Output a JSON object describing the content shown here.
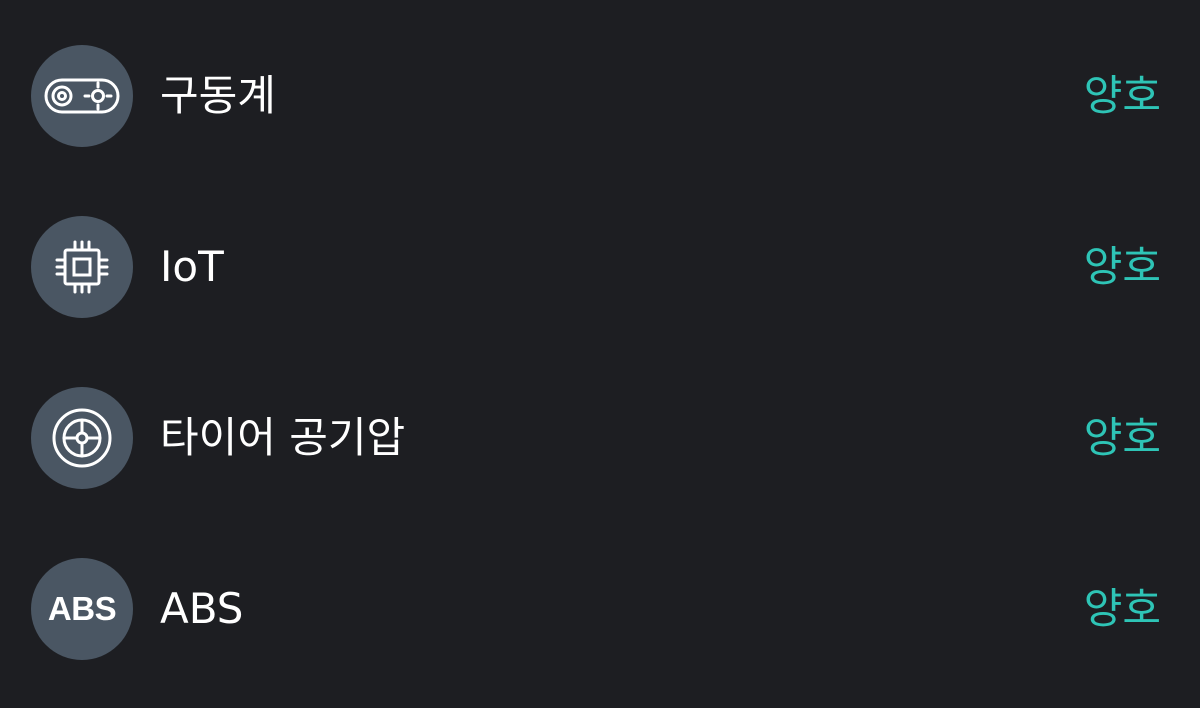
{
  "colors": {
    "background": "#1d1e22",
    "icon_background": "#4a5663",
    "label_text": "#ffffff",
    "status_ok": "#2ec4b6"
  },
  "items": [
    {
      "icon": "drivetrain-belt-icon",
      "label": "구동계",
      "status": "양호"
    },
    {
      "icon": "chip-icon",
      "label": "IoT",
      "status": "양호"
    },
    {
      "icon": "tire-icon",
      "label": "타이어 공기압",
      "status": "양호"
    },
    {
      "icon": "abs-icon",
      "icon_text": "ABS",
      "label": "ABS",
      "status": "양호"
    }
  ]
}
